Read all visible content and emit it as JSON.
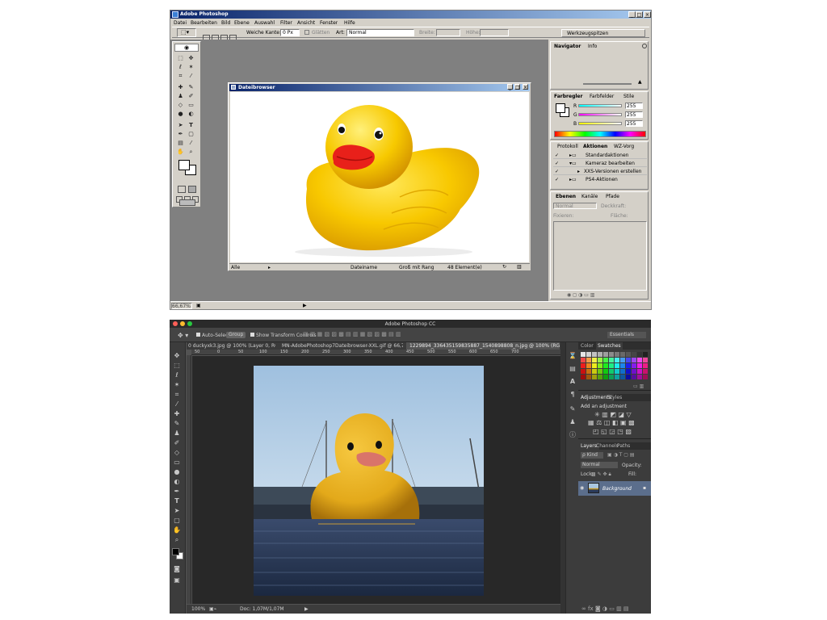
{
  "old": {
    "title": "Adobe Photoshop",
    "window_controls": [
      "_",
      "□",
      "×"
    ],
    "menu": [
      "Datei",
      "Bearbeiten",
      "Bild",
      "Ebene",
      "Auswahl",
      "Filter",
      "Ansicht",
      "Fenster",
      "Hilfe"
    ],
    "options": {
      "weiche_kante_label": "Weiche Kante:",
      "weiche_kante_value": "0 Px",
      "glaetten_label": "Glätten",
      "art_label": "Art:",
      "art_value": "Normal",
      "breite_label": "Breite:",
      "hoehe_label": "Höhe:",
      "werkzeugspitzen": "Werkzeugspitzen"
    },
    "browser": {
      "title": "Dateibrowser",
      "status": {
        "filter": "Alle",
        "sort": "Dateiname",
        "view": "Groß mit Rang",
        "count": "48 Element(e)"
      }
    },
    "navigator": {
      "tabs": [
        "Navigator",
        "Info"
      ]
    },
    "color": {
      "tabs": [
        "Farbregler",
        "Farbfelder",
        "Stile"
      ],
      "channels": [
        {
          "label": "R",
          "value": "255"
        },
        {
          "label": "G",
          "value": "255"
        },
        {
          "label": "B",
          "value": "255"
        }
      ]
    },
    "actions": {
      "tabs": [
        "Protokoll",
        "Aktionen",
        "WZ-Vorg"
      ],
      "items": [
        "Standardaktionen",
        "Kameraz bearbeiten",
        "XXS-Versionen erstellen",
        "PS4-Aktionen"
      ]
    },
    "layers": {
      "tabs": [
        "Ebenen",
        "Kanäle",
        "Pfade"
      ],
      "mode": "Normal",
      "opacity_label": "Deckkraft:",
      "lock_label": "Fixieren:",
      "fill_label": "Fläche:"
    },
    "statusbar": {
      "zoom": "66,67%"
    }
  },
  "new": {
    "title": "Adobe Photoshop CC",
    "options": {
      "auto_select_label": "Auto-Select:",
      "auto_select_value": "Group",
      "transform_label": "Show Transform Controls",
      "workspace": "Essentials"
    },
    "doc_tabs": [
      "0 duckyxk3.jpg @ 100% (Layer 0, RGB/8...",
      "MN-AdobePhotoshop7Dateibrowser-XXL.gif @ 66,7% (...",
      "1229894_336435159835887_1540898808_n.jpg @ 100% (RGB/8)"
    ],
    "ruler": [
      "50",
      "0",
      "50",
      "100",
      "150",
      "200",
      "250",
      "300",
      "350",
      "400",
      "450",
      "500",
      "550",
      "600",
      "650",
      "700"
    ],
    "color_panel": {
      "tabs": [
        "Color",
        "Swatches"
      ]
    },
    "adjustments": {
      "tabs": [
        "Adjustments",
        "Styles"
      ],
      "heading": "Add an adjustment"
    },
    "layers": {
      "tabs": [
        "Layers",
        "Channels",
        "Paths"
      ],
      "filter": "ρ Kind",
      "mode": "Normal",
      "opacity_label": "Opacity:",
      "lock_label": "Lock:",
      "fill_label": "Fill:",
      "layer_name": "Background"
    },
    "statusbar": {
      "zoom": "100%",
      "doc": "Doc: 1,07M/1,07M"
    }
  }
}
